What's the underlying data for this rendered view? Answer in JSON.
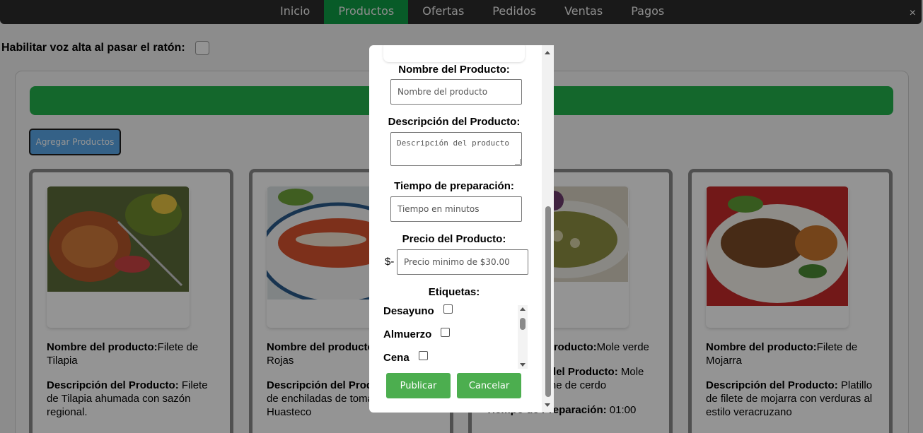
{
  "nav": {
    "items": [
      {
        "label": "Inicio"
      },
      {
        "label": "Productos"
      },
      {
        "label": "Ofertas"
      },
      {
        "label": "Pedidos"
      },
      {
        "label": "Ventas"
      },
      {
        "label": "Pagos"
      }
    ],
    "active_index": 1,
    "close_glyph": "×"
  },
  "voice": {
    "label": "Habilitar voz alta al pasar el ratón:"
  },
  "add_button": {
    "label": "Agregar Productos"
  },
  "cards": [
    {
      "name_label": "Nombre del producto:",
      "name": "Filete de Tilapia",
      "desc_label": "Descripción del Producto:",
      "desc": " Filete de Tilapia ahumada con sazón regional."
    },
    {
      "name_label": "Nombre del producto:",
      "name": "Enchiladas Rojas",
      "desc_label": "Descripción del Producto:",
      "desc": " Orden de enchiladas de tomate con sabor Huasteco"
    },
    {
      "name_label": "Nombre del producto:",
      "name": "Mole verde",
      "desc_label": "Descripción del Producto:",
      "desc": " Mole verde con carne de cerdo",
      "time_label": "Tiempo de Preparación:",
      "time": " 01:00"
    },
    {
      "name_label": "Nombre del producto:",
      "name": "Filete de Mojarra",
      "desc_label": "Descripción del Producto:",
      "desc": " Platillo de filete de mojarra con verduras al estilo veracruzano"
    }
  ],
  "modal": {
    "name_label": "Nombre del Producto:",
    "name_placeholder": "Nombre del producto",
    "desc_label": "Descripción del Producto:",
    "desc_placeholder": "Descripción del producto",
    "time_label": "Tiempo de preparación:",
    "time_placeholder": "Tiempo en minutos",
    "price_label": "Precio del Producto:",
    "currency": "$-",
    "price_placeholder": "Precio minimo de $30.00",
    "tags_label": "Etiquetas:",
    "tags": [
      {
        "label": "Desayuno"
      },
      {
        "label": "Almuerzo"
      },
      {
        "label": "Cena"
      }
    ],
    "publish_label": "Publicar",
    "cancel_label": "Cancelar"
  },
  "colors": {
    "nav_bg": "#2b2b2b",
    "nav_active": "#0f9d45",
    "green_bar": "#23b14d",
    "add_button": "#5aa8e8",
    "modal_button": "#4cae4f"
  }
}
